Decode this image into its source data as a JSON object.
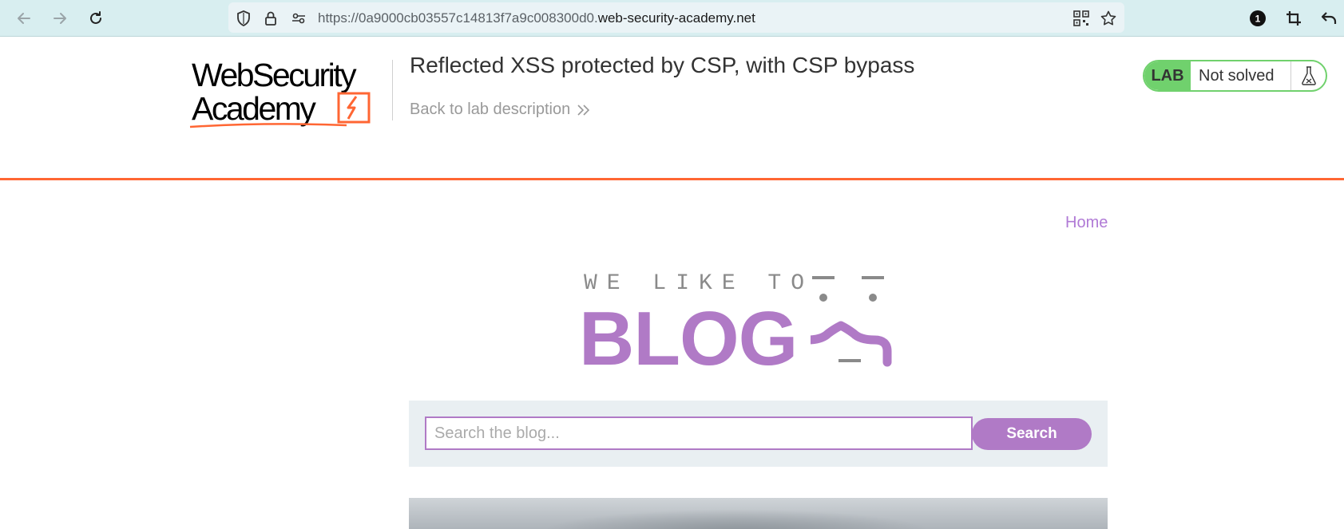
{
  "browser": {
    "url_prefix": "https://0a9000cb03557c14813f7a9c008300d0.",
    "url_domain": "web-security-academy.net",
    "badge_count": "1"
  },
  "academy": {
    "logo_line1": "WebSecurity",
    "logo_line2": "Academy",
    "lab_title": "Reflected XSS protected by CSP, with CSP bypass",
    "back_link": "Back to lab description",
    "lab_badge": "LAB",
    "lab_status": "Not solved"
  },
  "blog": {
    "nav_home": "Home",
    "tagline": "WE LIKE TO",
    "brand": "BLOG",
    "search_placeholder": "Search the blog...",
    "search_button": "Search"
  },
  "colors": {
    "accent_orange": "#ff6633",
    "blog_purple": "#b07ac6",
    "lab_green": "#70d16d"
  },
  "icons": [
    "back-arrow-icon",
    "forward-arrow-icon",
    "reload-icon",
    "shield-icon",
    "lock-icon",
    "permissions-icon",
    "qr-code-icon",
    "star-icon",
    "extension-badge-icon",
    "crop-icon",
    "undo-icon",
    "chevrons-right-icon",
    "flask-icon"
  ]
}
